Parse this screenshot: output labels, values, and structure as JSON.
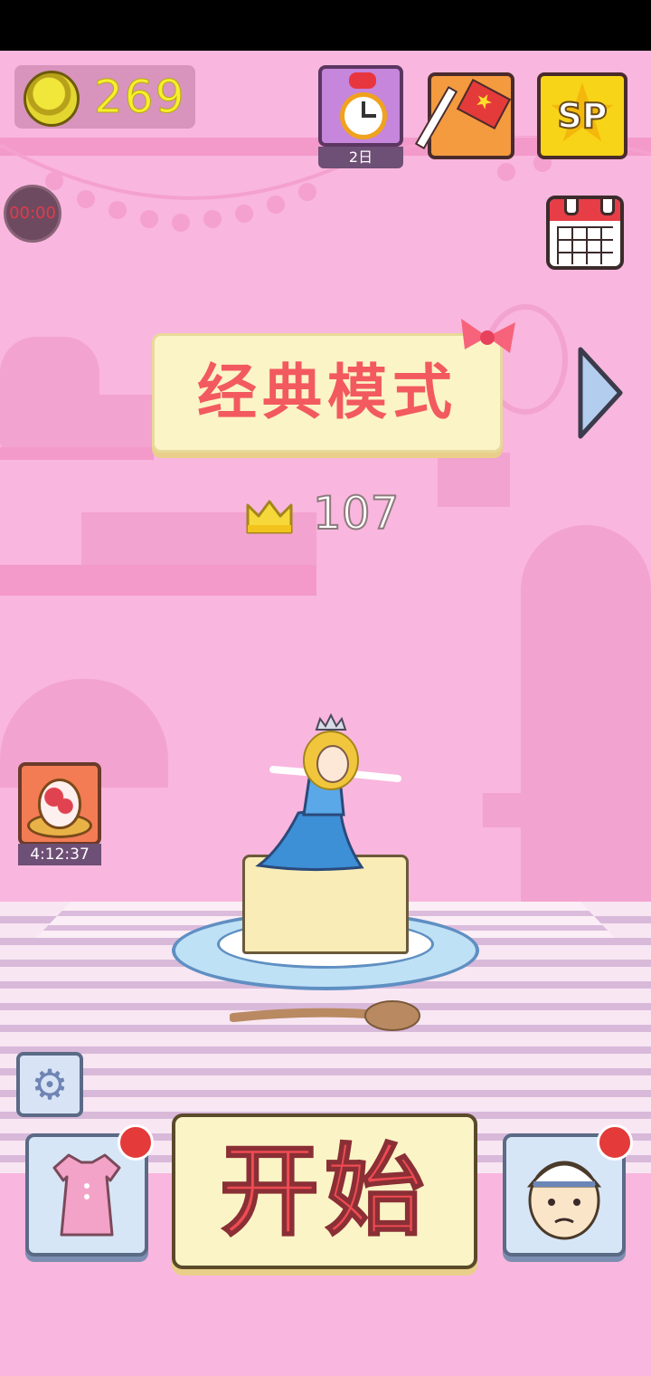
{
  "hud": {
    "coins": "269",
    "timer": "00:00",
    "daily_label": "2日"
  },
  "mode": {
    "title": "经典模式"
  },
  "best": {
    "score": "107"
  },
  "egg_reward": {
    "countdown": "4:12:37"
  },
  "start": {
    "label": "开始"
  },
  "colors": {
    "background": "#f9b6de",
    "accent_red": "#ef4b52",
    "coin_yellow": "#f7ef2e",
    "panel_cream": "#fbf4c7"
  },
  "icons": [
    "coin-icon",
    "alarm-clock-icon",
    "flag-icon",
    "sp-star-icon",
    "calendar-icon",
    "bow-icon",
    "next-arrow-icon",
    "crown-icon",
    "egg-icon",
    "gear-icon",
    "dress-icon",
    "chef-icon"
  ]
}
